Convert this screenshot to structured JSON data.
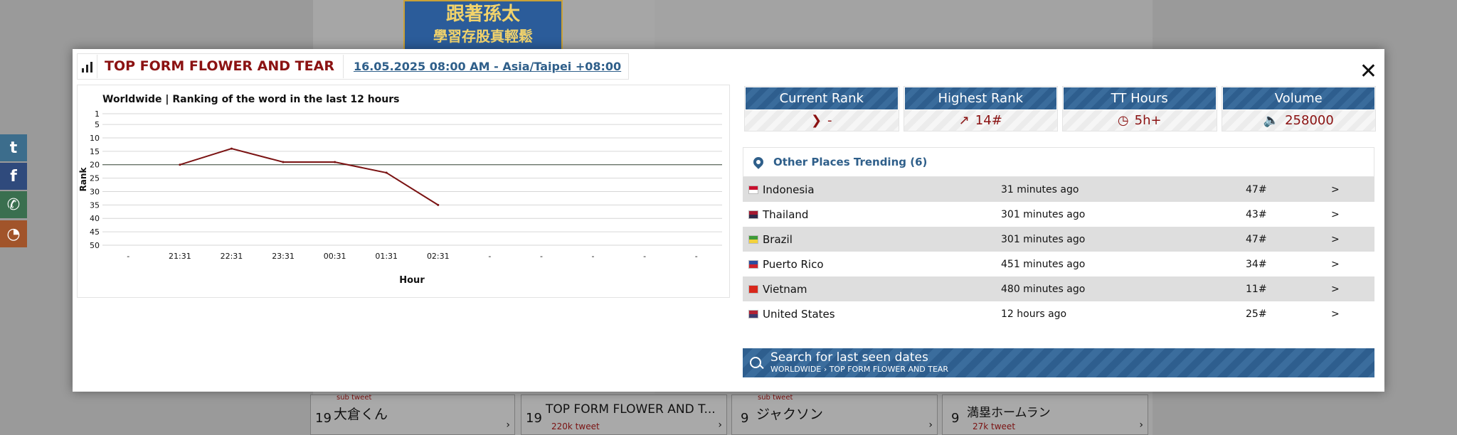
{
  "background": {
    "banner_line1": "跟著孫太",
    "banner_line2": "學習存股真輕鬆",
    "cells": [
      {
        "num": "19",
        "title": "大倉くん",
        "sub": "",
        "top": "sub tweet"
      },
      {
        "num": "19",
        "title": "TOP FORM FLOWER AND T...",
        "sub": "220k tweet",
        "top": ""
      },
      {
        "num": "9",
        "title": "ジャクソン",
        "sub": "",
        "top": "sub tweet"
      },
      {
        "num": "9",
        "title": "満塁ホームラン",
        "sub": "27k tweet",
        "top": ""
      }
    ]
  },
  "share": {
    "twitter": "twitter-icon",
    "facebook": "facebook-icon",
    "whatsapp": "whatsapp-icon",
    "rss": "rss-icon"
  },
  "modal": {
    "title": "TOP FORM FLOWER AND TEAR",
    "date": "16.05.2025 08:00 AM - Asia/Taipei +08:00",
    "close": "✕"
  },
  "chart_data": {
    "type": "line",
    "title": "Worldwide | Ranking of the word in the last 12 hours",
    "xlabel": "Hour",
    "ylabel": "Rank",
    "categories": [
      "-",
      "21:31",
      "22:31",
      "23:31",
      "00:31",
      "01:31",
      "02:31",
      "-",
      "-",
      "-",
      "-",
      "-"
    ],
    "yticks": [
      1,
      5,
      10,
      15,
      20,
      25,
      30,
      35,
      40,
      45,
      50
    ],
    "ylim": [
      1,
      50
    ],
    "y_reversed": true,
    "reference_line": 20,
    "series": [
      {
        "values": [
          null,
          20,
          14,
          19,
          19,
          23,
          35,
          null,
          null,
          null,
          null,
          null
        ],
        "color": "#7a1212"
      }
    ],
    "grid": true
  },
  "stats": [
    {
      "label": "Current Rank",
      "icon": "chevron-right-icon",
      "glyph": "❯",
      "value": "-"
    },
    {
      "label": "Highest Rank",
      "icon": "trending-up-icon",
      "glyph": "↗",
      "value": "14#"
    },
    {
      "label": "TT Hours",
      "icon": "clock-icon",
      "glyph": "◷",
      "value": "5h+"
    },
    {
      "label": "Volume",
      "icon": "speaker-icon",
      "glyph": "🔈",
      "value": "258000"
    }
  ],
  "places": {
    "label": "Other Places Trending (6)",
    "rows": [
      {
        "country": "Indonesia",
        "time": "31 minutes ago",
        "rank": "47#",
        "go": ">",
        "flag": [
          "#c8102e",
          "#ffffff"
        ]
      },
      {
        "country": "Thailand",
        "time": "301 minutes ago",
        "rank": "43#",
        "go": ">",
        "flag": [
          "#a51931",
          "#2d2a4a"
        ]
      },
      {
        "country": "Brazil",
        "time": "301 minutes ago",
        "rank": "47#",
        "go": ">",
        "flag": [
          "#3e9a3a",
          "#f2d23c"
        ]
      },
      {
        "country": "Puerto Rico",
        "time": "451 minutes ago",
        "rank": "34#",
        "go": ">",
        "flag": [
          "#2c4da0",
          "#d0222b"
        ]
      },
      {
        "country": "Vietnam",
        "time": "480 minutes ago",
        "rank": "11#",
        "go": ">",
        "flag": [
          "#d8271c",
          "#d8271c"
        ]
      },
      {
        "country": "United States",
        "time": "12 hours ago",
        "rank": "25#",
        "go": ">",
        "flag": [
          "#b22234",
          "#3c3b6e"
        ]
      }
    ]
  },
  "search": {
    "label": "Search for last seen dates",
    "breadcrumb": "WORLDWIDE › TOP FORM FLOWER AND TEAR"
  }
}
